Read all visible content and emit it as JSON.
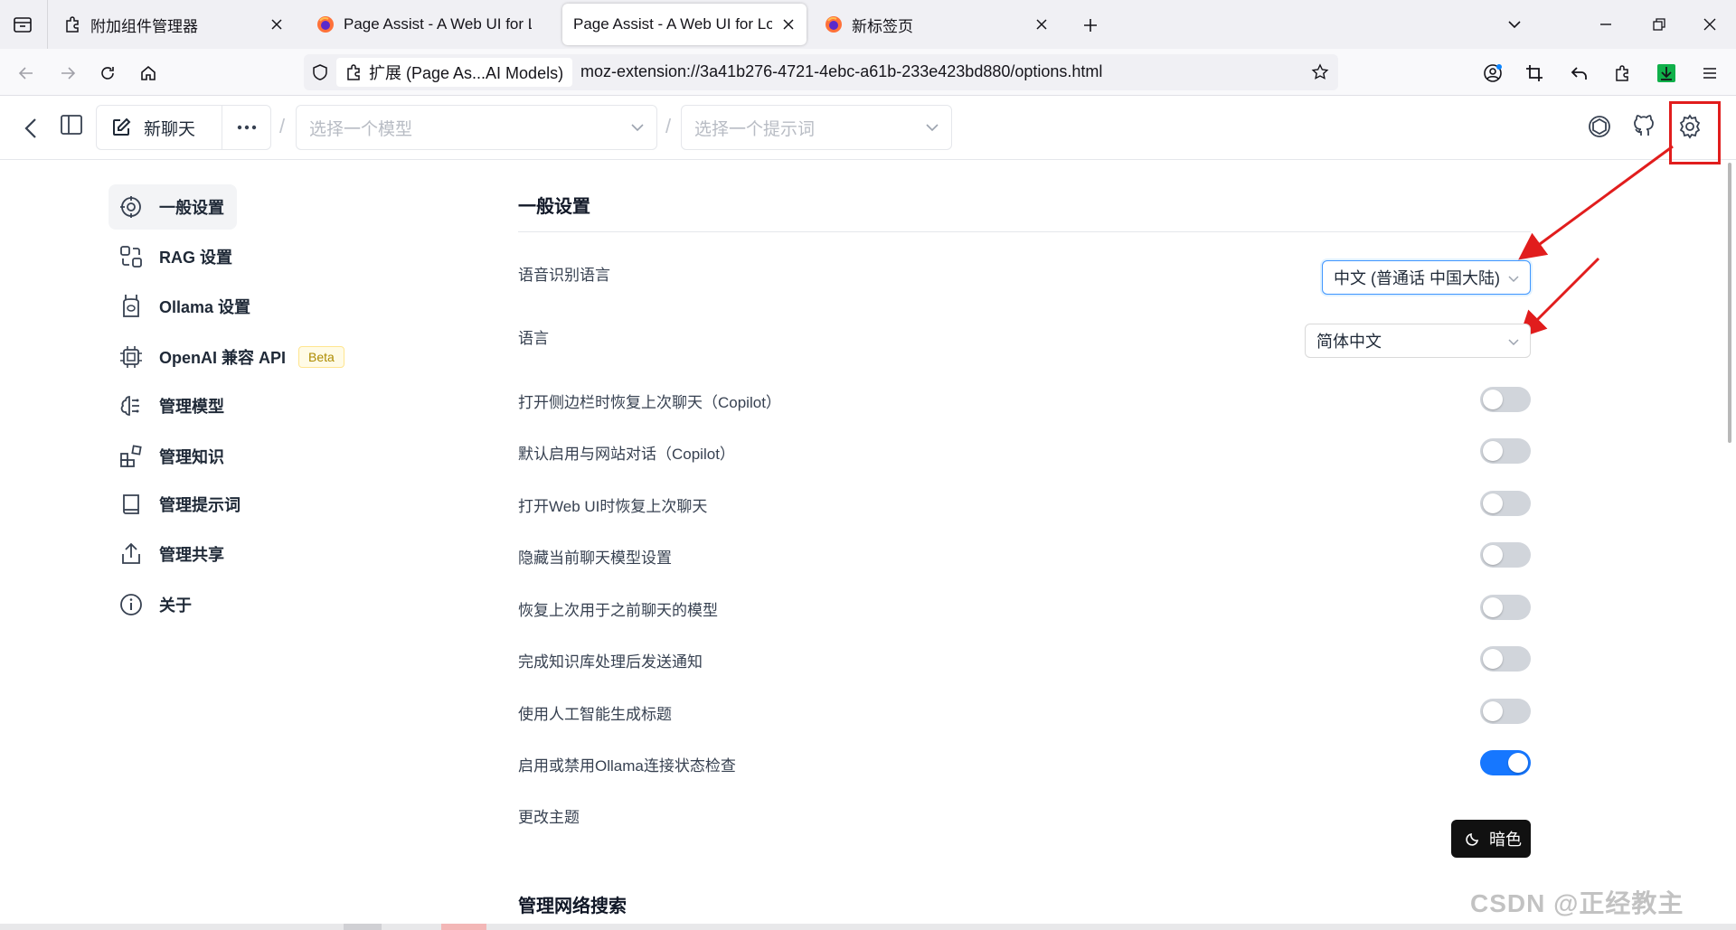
{
  "browser": {
    "tabs": [
      {
        "title": "附加组件管理器",
        "icon": "puzzle-icon",
        "active": false
      },
      {
        "title": "Page Assist - A Web UI for Lo",
        "icon": "firefox-icon",
        "active": false
      },
      {
        "title": "Page Assist - A Web UI for Local",
        "icon": "firefox-icon",
        "active": true
      },
      {
        "title": "新标签页",
        "icon": "firefox-icon",
        "active": false
      }
    ],
    "url_chip": "扩展 (Page As...AI Models)",
    "url": "moz-extension://3a41b276-4721-4ebc-a61b-233e423bd880/options.html"
  },
  "app_header": {
    "new_chat_label": "新聊天",
    "model_placeholder": "选择一个模型",
    "prompt_placeholder": "选择一个提示词"
  },
  "sidebar": {
    "items": [
      {
        "label": "一般设置",
        "icon": "settings-icon",
        "active": true
      },
      {
        "label": "RAG 设置",
        "icon": "rag-icon",
        "active": false
      },
      {
        "label": "Ollama 设置",
        "icon": "llama-icon",
        "active": false
      },
      {
        "label": "OpenAI 兼容 API",
        "icon": "chip-icon",
        "active": false,
        "badge": "Beta"
      },
      {
        "label": "管理模型",
        "icon": "brain-icon",
        "active": false
      },
      {
        "label": "管理知识",
        "icon": "blocks-icon",
        "active": false
      },
      {
        "label": "管理提示词",
        "icon": "book-icon",
        "active": false
      },
      {
        "label": "管理共享",
        "icon": "share-icon",
        "active": false
      },
      {
        "label": "关于",
        "icon": "info-icon",
        "active": false
      }
    ]
  },
  "main": {
    "section_title": "一般设置",
    "speech_language_label": "语音识别语言",
    "speech_language_value": "中文 (普通话 中国大陆)",
    "language_label": "语言",
    "language_value": "简体中文",
    "toggles": [
      {
        "label": "打开侧边栏时恢复上次聊天（Copilot）",
        "on": false
      },
      {
        "label": "默认启用与网站对话（Copilot）",
        "on": false
      },
      {
        "label": "打开Web UI时恢复上次聊天",
        "on": false
      },
      {
        "label": "隐藏当前聊天模型设置",
        "on": false
      },
      {
        "label": "恢复上次用于之前聊天的模型",
        "on": false
      },
      {
        "label": "完成知识库处理后发送通知",
        "on": false
      },
      {
        "label": "使用人工智能生成标题",
        "on": false
      },
      {
        "label": "启用或禁用Ollama连接状态检查",
        "on": true
      }
    ],
    "theme_label": "更改主题",
    "theme_button": "暗色",
    "next_section_title": "管理网络搜索"
  },
  "watermark": "CSDN @正经教主",
  "colors": {
    "accent": "#1677ff",
    "annotation": "#e11d1d"
  }
}
